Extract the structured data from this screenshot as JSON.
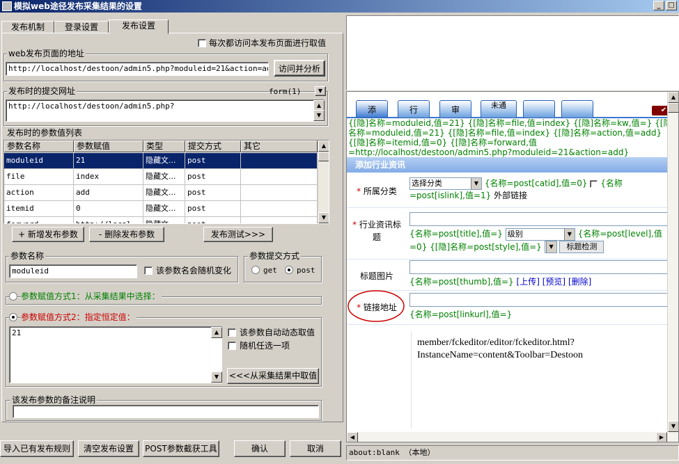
{
  "window": {
    "title": "模拟web途径发布采集结果的设置",
    "controls": [
      "_",
      "□",
      "×"
    ]
  },
  "tabs": [
    {
      "label": "发布机制"
    },
    {
      "label": "登录设置"
    },
    {
      "label": "发布设置"
    }
  ],
  "publish": {
    "visit_each_label": "每次都访问本发布页面进行取值",
    "web_page_group": "web发布页面的地址",
    "web_page_url": "http://localhost/destoon/admin5.php?moduleid=21&action=add",
    "visit_analyze_button": "访问并分析",
    "submit_url_group": "发布时的提交网址",
    "form_selector": "form(1)",
    "submit_url": "http://localhost/destoon/admin5.php?",
    "param_list_group": "发布时的参数值列表",
    "columns": [
      "参数名称",
      "参数赋值",
      "类型",
      "提交方式",
      "其它"
    ],
    "rows": [
      [
        "moduleid",
        "21",
        "隐藏文...",
        "post",
        ""
      ],
      [
        "file",
        "index",
        "隐藏文...",
        "post",
        ""
      ],
      [
        "action",
        "add",
        "隐藏文...",
        "post",
        ""
      ],
      [
        "itemid",
        "0",
        "隐藏文...",
        "post",
        ""
      ],
      [
        "forward",
        "http://local",
        "隐藏文...",
        "post",
        ""
      ]
    ],
    "add_param_button": "+ 新增发布参数",
    "remove_param_button": "- 删除发布参数",
    "test_button": "发布测试>>>",
    "param_name_group": "参数名称",
    "param_name_value": "moduleid",
    "random_name_label": "该参数名会随机变化",
    "submit_method_group": "参数提交方式",
    "method_get": "get",
    "method_post": "post",
    "mode1_label": "参数赋值方式1：从采集结果中选择：",
    "mode2_label": "参数赋值方式2：指定恒定值：",
    "constant_value": "21",
    "auto_dynamic_label": "该参数自动动态取值",
    "random_pick_label": "随机任选一项",
    "from_result_button": "<<<从采集结果中取值",
    "note_group": "该发布参数的备注说明"
  },
  "footer": {
    "import_button": "导入已有发布规则",
    "clear_button": "清空发布设置",
    "post_capture_button": "POST参数截获工具",
    "ok_button": "确认",
    "cancel_button": "取消"
  },
  "browser": {
    "tabs": [
      "添",
      "行",
      "审",
      "未通",
      "",
      ""
    ],
    "hidden_fields_text": "{[隐]名称=moduleid,值=21} {[隐]名称=file,值=index} {[隐]名称=kw,值=} {[隐]名称=moduleid,值=21} {[隐]名称=file,值=index} {[隐]名称=action,值=add} {[隐]名称=itemid,值=0} {[隐]名称=forward,值=http://localhost/destoon/admin5.php?moduleid=21&action=add}",
    "section_title": "添加行业资讯",
    "fields": {
      "category_label": "所属分类",
      "category_select": "选择分类",
      "category_info": "{名称=post[catid],值=0}",
      "islink_info": "{名称=post[islink],值=1}",
      "external_link": "外部链接",
      "title_label": "行业资讯标题",
      "title_info": "{名称=post[title],值=}",
      "level_select": "级别",
      "level_info": "{名称=post[level],值=0}",
      "style_info": "{[隐]名称=post[style],值=}",
      "title_check_button": "标题检测",
      "thumb_label": "标题图片",
      "thumb_info": "{名称=post[thumb],值=}",
      "upload_link": "[上传]",
      "preview_link": "[预览]",
      "delete_link": "[删除]",
      "link_label": "链接地址",
      "link_info": "{名称=post[linkurl],值=}",
      "editor_text_1": "member/fckeditor/editor/fckeditor.html?",
      "editor_text_2": "InstanceName=content&Toolbar=Destoon"
    },
    "status_text": "about:blank （本地）"
  },
  "colors": {
    "titlebar": "#0a246a",
    "selection": "#0a246a",
    "hidden_green": "#008000",
    "required_red": "#cc0000",
    "section_blue": "#3a78d0"
  }
}
